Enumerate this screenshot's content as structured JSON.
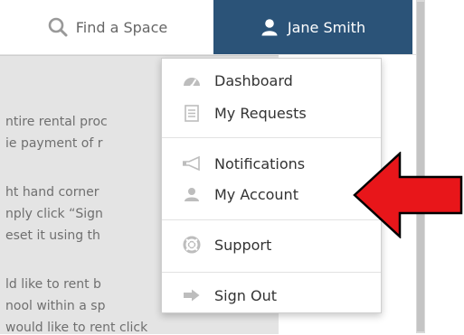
{
  "nav": {
    "find_space": "Find a Space",
    "user_name": "Jane Smith"
  },
  "content": {
    "lines": [
      "ntire rental proc",
      "ie payment of r",
      "ht hand corner",
      "nply click “Sign",
      "eset it using th",
      "ld like to rent b",
      "nool within a sp",
      "would like to rent  click"
    ]
  },
  "menu": {
    "items": [
      {
        "label": "Dashboard",
        "icon": "dashboard-icon"
      },
      {
        "label": "My Requests",
        "icon": "document-icon"
      },
      {
        "label": "Notifications",
        "icon": "megaphone-icon"
      },
      {
        "label": "My Account",
        "icon": "user-icon"
      },
      {
        "label": "Support",
        "icon": "lifebuoy-icon"
      },
      {
        "label": "Sign Out",
        "icon": "sign-out-icon"
      }
    ]
  },
  "colors": {
    "nav_accent": "#2b5378",
    "annotation_arrow": "#e8161a"
  }
}
